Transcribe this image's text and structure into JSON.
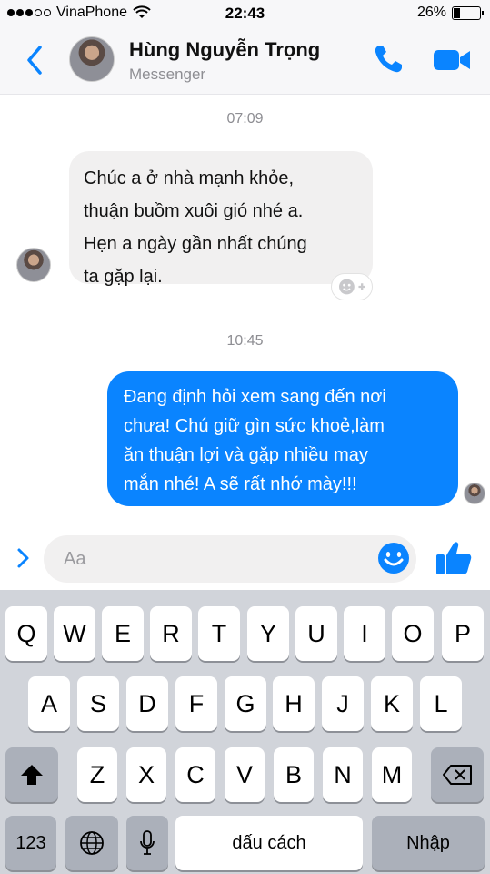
{
  "status_bar": {
    "carrier": "VinaPhone",
    "time": "22:43",
    "battery": "26%",
    "battery_level": 0.26,
    "signal_bars": 3
  },
  "header": {
    "name": "Hùng Nguyễn Trọng",
    "subtitle": "Messenger",
    "icons": [
      "back-chevron-icon",
      "phone-icon",
      "video-camera-icon"
    ],
    "accent": "#0a84ff"
  },
  "messages": [
    {
      "timestamp": "07:09"
    },
    {
      "direction": "incoming",
      "lines": [
        "Chúc a ở nhà mạnh khỏe,",
        "thuận buồm xuôi gió nhé a.",
        "Hẹn a ngày gần nhất chúng",
        "ta gặp lại."
      ]
    },
    {
      "timestamp": "10:45"
    },
    {
      "direction": "outgoing",
      "lines": [
        "Đang định hỏi xem sang đến nơi",
        "chưa! Chú giữ gìn sức khoẻ,làm",
        "ăn thuận lợi và gặp nhiều may",
        "mắn nhé! A sẽ rất nhớ mày!!!"
      ]
    }
  ],
  "composer": {
    "placeholder": "Aa",
    "icons": [
      "chevron-right-icon",
      "emoji-icon",
      "thumbs-up-icon"
    ]
  },
  "keyboard": {
    "row1": [
      "Q",
      "W",
      "E",
      "R",
      "T",
      "Y",
      "U",
      "I",
      "O",
      "P"
    ],
    "row2": [
      "A",
      "S",
      "D",
      "F",
      "G",
      "H",
      "J",
      "K",
      "L"
    ],
    "row3": [
      "Z",
      "X",
      "C",
      "V",
      "B",
      "N",
      "M"
    ],
    "numbers_label": "123",
    "space_label": "dấu cách",
    "return_label": "Nhập"
  }
}
